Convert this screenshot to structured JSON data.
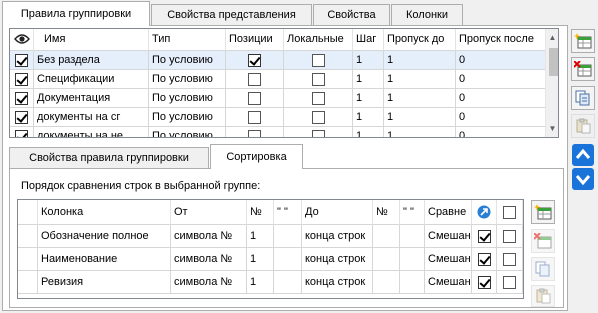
{
  "outer_tabs": [
    {
      "label": "Правила группировки",
      "active": true
    },
    {
      "label": "Свойства представления",
      "active": false
    },
    {
      "label": "Свойства",
      "active": false
    },
    {
      "label": "Колонки",
      "active": false
    }
  ],
  "rules_grid": {
    "columns": [
      "",
      "Имя",
      "Тип",
      "Позиции",
      "Локальные",
      "Шаг",
      "Пропуск до",
      "Пропуск после"
    ],
    "rows": [
      {
        "enabled": true,
        "name": "Без раздела",
        "type": "По условию",
        "positions": true,
        "local": false,
        "step": "1",
        "skip_before": "1",
        "skip_after": "0",
        "selected": true
      },
      {
        "enabled": true,
        "name": "Спецификации",
        "type": "По условию",
        "positions": false,
        "local": false,
        "step": "1",
        "skip_before": "1",
        "skip_after": "0",
        "selected": false
      },
      {
        "enabled": true,
        "name": "Документация",
        "type": "По условию",
        "positions": false,
        "local": false,
        "step": "1",
        "skip_before": "1",
        "skip_after": "0",
        "selected": false
      },
      {
        "enabled": true,
        "name": "документы на сг",
        "type": "По условию",
        "positions": false,
        "local": false,
        "step": "1",
        "skip_before": "1",
        "skip_after": "0",
        "selected": false
      },
      {
        "enabled": true,
        "name": "документы на не",
        "type": "По условию",
        "positions": false,
        "local": false,
        "step": "1",
        "skip_before": "1",
        "skip_after": "0",
        "selected": false
      }
    ]
  },
  "inner_tabs": [
    {
      "label": "Свойства правила группировки",
      "active": false
    },
    {
      "label": "Сортировка",
      "active": true
    }
  ],
  "sort_caption": "Порядок сравнения строк в выбранной группе:",
  "sort_grid": {
    "columns": [
      "",
      "Колонка",
      "От",
      "№",
      "\" \"",
      "До",
      "№",
      "\" \"",
      "Сравне",
      "",
      ""
    ],
    "rows": [
      {
        "column": "Обозначение полное",
        "from": "символа №",
        "from_n": "1",
        "from_q": "",
        "to": "конца строк",
        "to_n": "",
        "to_q": "",
        "compare": "Смешан",
        "check_a": true,
        "check_b": false
      },
      {
        "column": "Наименование",
        "from": "символа №",
        "from_n": "1",
        "from_q": "",
        "to": "конца строк",
        "to_n": "",
        "to_q": "",
        "compare": "Смешан",
        "check_a": true,
        "check_b": false
      },
      {
        "column": "Ревизия",
        "from": "символа №",
        "from_n": "1",
        "from_q": "",
        "to": "конца строк",
        "to_n": "",
        "to_q": "",
        "compare": "Смешан",
        "check_a": true,
        "check_b": false
      }
    ]
  },
  "icons": {
    "eye": "eye-icon",
    "add_row": "add-row-icon",
    "delete_row": "delete-row-icon",
    "copy": "copy-icon",
    "paste": "paste-icon",
    "move_up": "arrow-up-icon",
    "move_down": "arrow-down-icon",
    "sort_direction": "sort-direction-icon"
  },
  "colors": {
    "accent": "#2a7fd4",
    "selection": "#e5eefb"
  }
}
